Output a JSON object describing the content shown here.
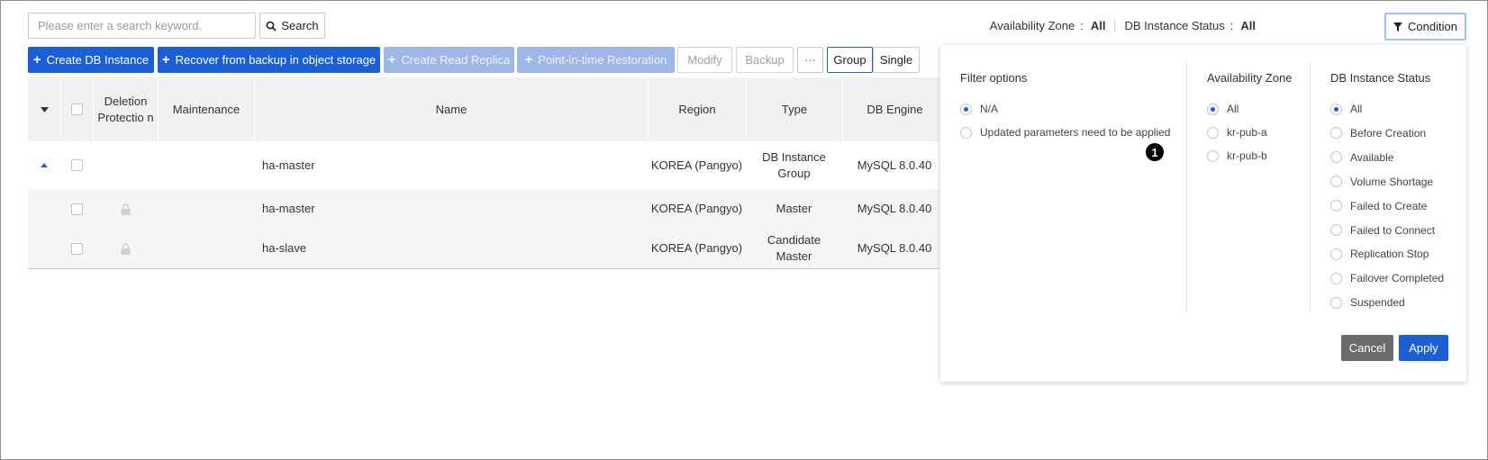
{
  "search": {
    "placeholder": "Please enter a search keyword.",
    "button_label": "Search"
  },
  "status_bar": {
    "az_label": "Availability Zone",
    "az_value": "All",
    "status_label": "DB Instance Status",
    "status_value": "All",
    "separator": ":",
    "condition_label": "Condition"
  },
  "toolbar": {
    "create_db": "Create DB Instance",
    "recover_backup": "Recover from backup in object storage",
    "create_replica": "Create Read Replica",
    "pitr": "Point-in-time Restoration",
    "modify": "Modify",
    "backup": "Backup",
    "more": "···",
    "group": "Group",
    "single": "Single"
  },
  "table": {
    "headers": {
      "deletion_protection": "Deletion Protectio n",
      "maintenance": "Maintenance",
      "name": "Name",
      "region": "Region",
      "type": "Type",
      "db_engine": "DB Engine"
    },
    "rows": [
      {
        "name": "ha-master",
        "region": "KOREA (Pangyo)",
        "type": "DB Instance Group",
        "engine": "MySQL 8.0.40"
      },
      {
        "name": "ha-master",
        "region": "KOREA (Pangyo)",
        "type": "Master",
        "engine": "MySQL 8.0.40"
      },
      {
        "name": "ha-slave",
        "region": "KOREA (Pangyo)",
        "type": "Candidate Master",
        "engine": "MySQL 8.0.40"
      }
    ]
  },
  "panel": {
    "filter_title": "Filter options",
    "filter_options": [
      "N/A",
      "Updated parameters need to be applied"
    ],
    "filter_selected": "N/A",
    "az_title": "Availability Zone",
    "az_options": [
      "All",
      "kr-pub-a",
      "kr-pub-b"
    ],
    "az_selected": "All",
    "status_title": "DB Instance Status",
    "status_options": [
      "All",
      "Before Creation",
      "Available",
      "Volume Shortage",
      "Failed to Create",
      "Failed to Connect",
      "Replication Stop",
      "Failover Completed",
      "Suspended"
    ],
    "status_selected": "All",
    "cancel_label": "Cancel",
    "apply_label": "Apply",
    "badge": "1"
  },
  "colors": {
    "primary": "#1a5fd6",
    "primary_disabled": "#9db7e6",
    "cancel": "#6b6b6b"
  }
}
